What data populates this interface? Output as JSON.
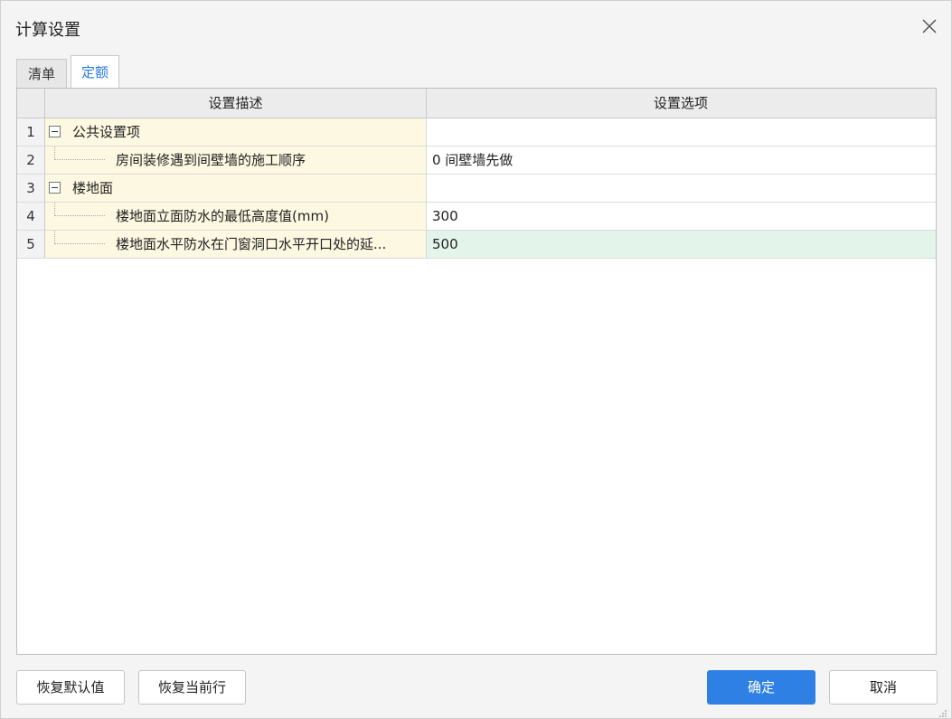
{
  "dialog": {
    "title": "计算设置",
    "close_icon": "close-icon"
  },
  "tabs": [
    {
      "label": "清单",
      "active": false
    },
    {
      "label": "定额",
      "active": true
    }
  ],
  "grid": {
    "columns": [
      "设置描述",
      "设置选项"
    ],
    "rows": [
      {
        "num": "1",
        "type": "group",
        "description": "公共设置项",
        "value": ""
      },
      {
        "num": "2",
        "type": "child",
        "description": "房间装修遇到间壁墙的施工顺序",
        "value": "0 间壁墙先做"
      },
      {
        "num": "3",
        "type": "group",
        "description": "楼地面",
        "value": ""
      },
      {
        "num": "4",
        "type": "child",
        "description": "楼地面立面防水的最低高度值(mm)",
        "value": "300"
      },
      {
        "num": "5",
        "type": "child",
        "description": "楼地面水平防水在门窗洞口水平开口处的延...",
        "value": "500",
        "selected": true
      }
    ]
  },
  "buttons": {
    "restore_default": "恢复默认值",
    "restore_current_row": "恢复当前行",
    "ok": "确定",
    "cancel": "取消"
  },
  "colors": {
    "accent": "#2f80e4",
    "desc_bg": "#fdf8e1",
    "selected_bg": "#e3f5ea"
  }
}
